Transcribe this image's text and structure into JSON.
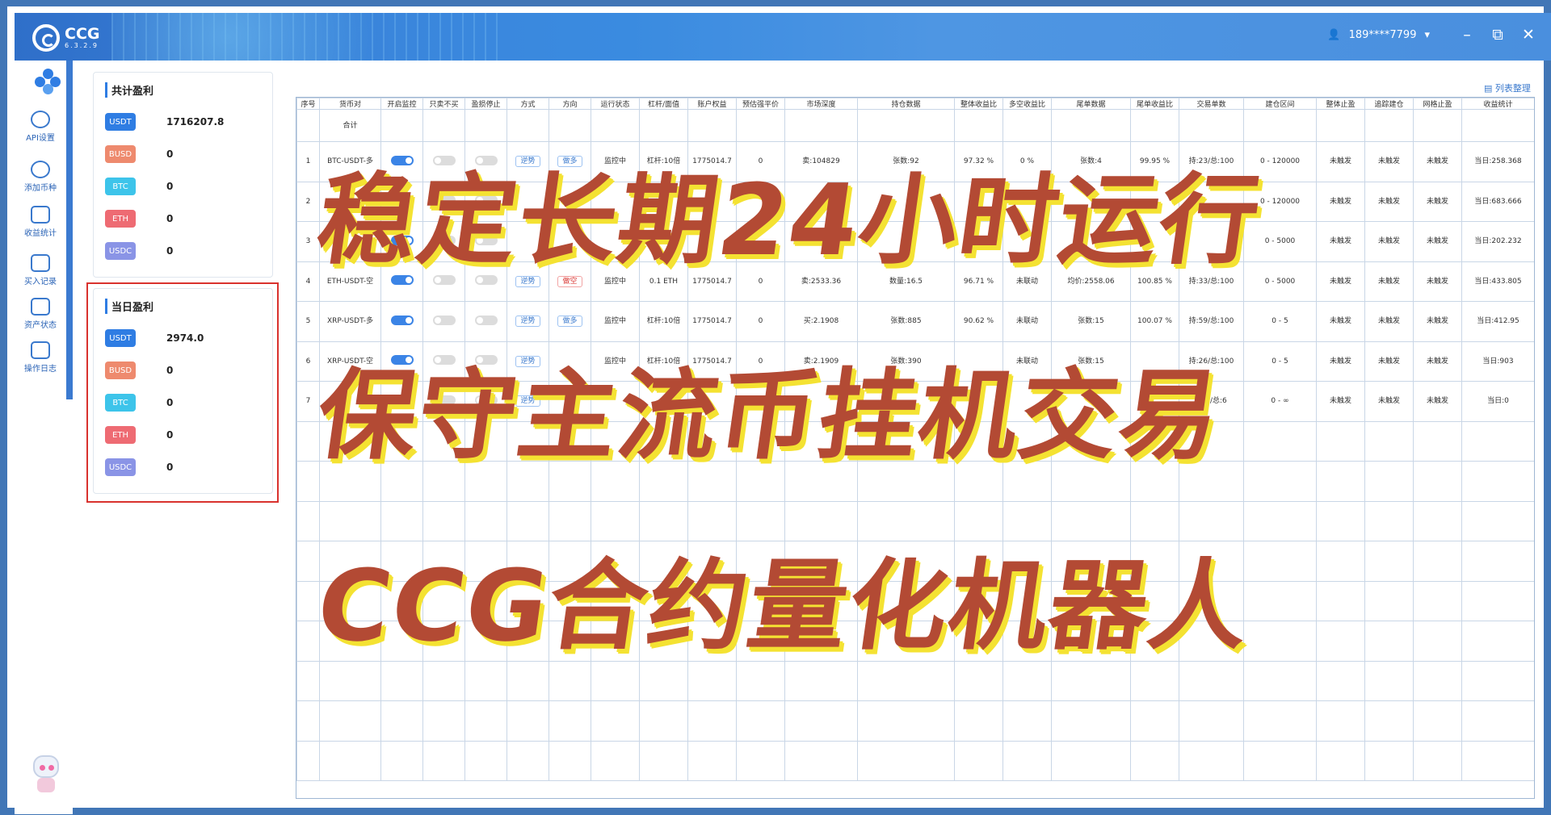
{
  "app": {
    "name": "CCG",
    "version": "6.3.2.9"
  },
  "user": {
    "phone": "189****7799"
  },
  "sidebar": {
    "items": [
      {
        "label": "API设置",
        "icon": "gear-icon"
      },
      {
        "label": "添加币种",
        "icon": "add-coin-icon"
      },
      {
        "label": "收益统计",
        "icon": "chart-icon"
      },
      {
        "label": "买入记录",
        "icon": "record-icon"
      },
      {
        "label": "资产状态",
        "icon": "wallet-icon"
      },
      {
        "label": "操作日志",
        "icon": "log-icon"
      }
    ]
  },
  "total_profit": {
    "title": "共计盈利",
    "rows": [
      {
        "coin": "USDT",
        "value": "1716207.8",
        "color": "#2f7de3"
      },
      {
        "coin": "BUSD",
        "value": "0",
        "color": "#ee8a6e"
      },
      {
        "coin": "BTC",
        "value": "0",
        "color": "#3dc4ea"
      },
      {
        "coin": "ETH",
        "value": "0",
        "color": "#ee6b73"
      },
      {
        "coin": "USDC",
        "value": "0",
        "color": "#8a94e6"
      }
    ]
  },
  "daily_profit": {
    "title": "当日盈利",
    "rows": [
      {
        "coin": "USDT",
        "value": "2974.0",
        "color": "#2f7de3"
      },
      {
        "coin": "BUSD",
        "value": "0",
        "color": "#ee8a6e"
      },
      {
        "coin": "BTC",
        "value": "0",
        "color": "#3dc4ea"
      },
      {
        "coin": "ETH",
        "value": "0",
        "color": "#ee6b73"
      },
      {
        "coin": "USDC",
        "value": "0",
        "color": "#8a94e6"
      }
    ]
  },
  "list_button": "列表整理",
  "table": {
    "headers": [
      "序号",
      "货币对",
      "开启监控",
      "只卖不买",
      "盈损停止",
      "方式",
      "方向",
      "运行状态",
      "杠杆/面值",
      "账户权益",
      "预估强平价",
      "市场深度",
      "持仓数据",
      "整体收益比",
      "多空收益比",
      "尾单数据",
      "尾单收益比",
      "交易单数",
      "建仓区间",
      "整体止盈",
      "追踪建仓",
      "网格止盈",
      "收益统计"
    ],
    "sum_label": "合计",
    "rows": [
      {
        "n": "1",
        "pair": "BTC-USDT-多",
        "mode": "逆势",
        "dir": "做多",
        "status": "监控中",
        "lev": "杠杆:10倍",
        "equity": "1775014.7",
        "liq": "0",
        "depth": "卖:104829",
        "pos": "张数:92",
        "total": "97.32 %",
        "ls": "0 %",
        "tail": "张数:4",
        "tailr": "99.95 %",
        "cnt": "持:23/总:100",
        "range": "0 - 120000",
        "tp": "未触发",
        "trail": "未触发",
        "grid": "未触发",
        "stat": "当日:258.368"
      },
      {
        "n": "2",
        "pair": "",
        "mode": "",
        "dir": "",
        "status": "",
        "lev": "",
        "equity": "",
        "liq": "",
        "depth": "",
        "pos": "",
        "total": "",
        "ls": "",
        "tail": "",
        "tailr": "",
        "cnt": "",
        "range": "0 - 120000",
        "tp": "未触发",
        "trail": "未触发",
        "grid": "未触发",
        "stat": "当日:683.666"
      },
      {
        "n": "3",
        "pair": "",
        "mode": "",
        "dir": "",
        "status": "",
        "lev": "",
        "equity": "",
        "liq": "",
        "depth": "",
        "pos": "",
        "total": "",
        "ls": "",
        "tail": "",
        "tailr": "",
        "cnt": "",
        "range": "0 - 5000",
        "tp": "未触发",
        "trail": "未触发",
        "grid": "未触发",
        "stat": "当日:202.232"
      },
      {
        "n": "4",
        "pair": "ETH-USDT-空",
        "mode": "逆势",
        "dir": "做空",
        "status": "监控中",
        "lev": "0.1 ETH",
        "equity": "1775014.7",
        "liq": "0",
        "depth": "卖:2533.36",
        "pos": "数量:16.5",
        "total": "96.71 %",
        "ls": "未联动",
        "tail": "均价:2558.06",
        "tailr": "100.85 %",
        "cnt": "持:33/总:100",
        "range": "0 - 5000",
        "tp": "未触发",
        "trail": "未触发",
        "grid": "未触发",
        "stat": "当日:433.805"
      },
      {
        "n": "5",
        "pair": "XRP-USDT-多",
        "mode": "逆势",
        "dir": "做多",
        "status": "监控中",
        "lev": "杠杆:10倍",
        "equity": "1775014.7",
        "liq": "0",
        "depth": "买:2.1908",
        "pos": "张数:885",
        "total": "90.62 %",
        "ls": "未联动",
        "tail": "张数:15",
        "tailr": "100.07 %",
        "cnt": "持:59/总:100",
        "range": "0 - 5",
        "tp": "未触发",
        "trail": "未触发",
        "grid": "未触发",
        "stat": "当日:412.95"
      },
      {
        "n": "6",
        "pair": "XRP-USDT-空",
        "mode": "逆势",
        "dir": "",
        "status": "监控中",
        "lev": "杠杆:10倍",
        "equity": "1775014.7",
        "liq": "0",
        "depth": "卖:2.1909",
        "pos": "张数:390",
        "total": "",
        "ls": "未联动",
        "tail": "张数:15",
        "tailr": "",
        "cnt": "持:26/总:100",
        "range": "0 - 5",
        "tp": "未触发",
        "trail": "未触发",
        "grid": "未触发",
        "stat": "当日:903"
      },
      {
        "n": "7",
        "pair": "",
        "mode": "逆势",
        "dir": "",
        "status": "",
        "lev": "",
        "equity": "",
        "liq": "",
        "depth": "",
        "pos": "",
        "total": "",
        "ls": "",
        "tail": "",
        "tailr": "",
        "cnt": "持:0/总:6",
        "range": "0 - ∞",
        "tp": "未触发",
        "trail": "未触发",
        "grid": "未触发",
        "stat": "当日:0"
      }
    ]
  },
  "overlay": {
    "line1": "稳定长期24小时运行",
    "line2": "保守主流币挂机交易",
    "line3": "CCG合约量化机器人"
  }
}
